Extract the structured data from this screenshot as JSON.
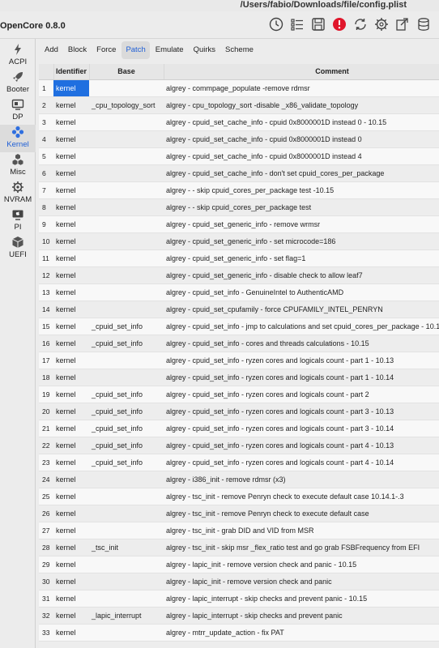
{
  "window": {
    "path": "/Users/fabio/Downloads/file/config.plist"
  },
  "toolbar": {
    "app_name": "OpenCore 0.8.0"
  },
  "sidebar": {
    "items": [
      {
        "label": "ACPI",
        "icon": "bolt-icon"
      },
      {
        "label": "Booter",
        "icon": "rocket-icon"
      },
      {
        "label": "DP",
        "icon": "display-icon"
      },
      {
        "label": "Kernel",
        "icon": "kernel-icon"
      },
      {
        "label": "Misc",
        "icon": "cubes-icon"
      },
      {
        "label": "NVRAM",
        "icon": "chip-icon"
      },
      {
        "label": "PI",
        "icon": "apple-icon"
      },
      {
        "label": "UEFI",
        "icon": "box-icon"
      }
    ],
    "active": "Kernel"
  },
  "tabs": [
    "Add",
    "Block",
    "Force",
    "Patch",
    "Emulate",
    "Quirks",
    "Scheme"
  ],
  "active_tab": "Patch",
  "table": {
    "headers": {
      "identifier": "Identifier",
      "base": "Base",
      "comment": "Comment"
    },
    "rows": [
      {
        "n": "1",
        "identifier": "kernel",
        "base": "",
        "comment": "algrey - commpage_populate -remove rdmsr"
      },
      {
        "n": "2",
        "identifier": "kernel",
        "base": "_cpu_topology_sort",
        "comment": "algrey - cpu_topology_sort -disable _x86_validate_topology"
      },
      {
        "n": "3",
        "identifier": "kernel",
        "base": "",
        "comment": "algrey - cpuid_set_cache_info - cpuid 0x8000001D instead 0 - 10.15"
      },
      {
        "n": "4",
        "identifier": "kernel",
        "base": "",
        "comment": "algrey - cpuid_set_cache_info - cpuid 0x8000001D instead 0"
      },
      {
        "n": "5",
        "identifier": "kernel",
        "base": "",
        "comment": "algrey - cpuid_set_cache_info - cpuid 0x8000001D instead 4"
      },
      {
        "n": "6",
        "identifier": "kernel",
        "base": "",
        "comment": "algrey - cpuid_set_cache_info - don't set cpuid_cores_per_package"
      },
      {
        "n": "7",
        "identifier": "kernel",
        "base": "",
        "comment": "algrey - - skip cpuid_cores_per_package test -10.15"
      },
      {
        "n": "8",
        "identifier": "kernel",
        "base": "",
        "comment": "algrey - - skip cpuid_cores_per_package test"
      },
      {
        "n": "9",
        "identifier": "kernel",
        "base": "",
        "comment": "algrey - cpuid_set_generic_info - remove wrmsr"
      },
      {
        "n": "10",
        "identifier": "kernel",
        "base": "",
        "comment": "algrey - cpuid_set_generic_info - set microcode=186"
      },
      {
        "n": "11",
        "identifier": "kernel",
        "base": "",
        "comment": "algrey - cpuid_set_generic_info - set flag=1"
      },
      {
        "n": "12",
        "identifier": "kernel",
        "base": "",
        "comment": "algrey - cpuid_set_generic_info - disable check to allow leaf7"
      },
      {
        "n": "13",
        "identifier": "kernel",
        "base": "",
        "comment": "algrey - cpuid_set_info - GenuineIntel to AuthenticAMD"
      },
      {
        "n": "14",
        "identifier": "kernel",
        "base": "",
        "comment": "algrey - cpuid_set_cpufamily - force CPUFAMILY_INTEL_PENRYN"
      },
      {
        "n": "15",
        "identifier": "kernel",
        "base": "_cpuid_set_info",
        "comment": "algrey - cpuid_set_info - jmp to calculations and set cpuid_cores_per_package - 10.1"
      },
      {
        "n": "16",
        "identifier": "kernel",
        "base": "_cpuid_set_info",
        "comment": "algrey - cpuid_set_info - cores and threads calculations - 10.15"
      },
      {
        "n": "17",
        "identifier": "kernel",
        "base": "",
        "comment": "algrey - cpuid_set_info - ryzen cores and logicals count - part 1 - 10.13"
      },
      {
        "n": "18",
        "identifier": "kernel",
        "base": "",
        "comment": "algrey - cpuid_set_info - ryzen cores and logicals count - part 1 - 10.14"
      },
      {
        "n": "19",
        "identifier": "kernel",
        "base": "_cpuid_set_info",
        "comment": "algrey - cpuid_set_info - ryzen cores and logicals count - part 2"
      },
      {
        "n": "20",
        "identifier": "kernel",
        "base": "_cpuid_set_info",
        "comment": "algrey - cpuid_set_info - ryzen cores and logicals count - part 3 - 10.13"
      },
      {
        "n": "21",
        "identifier": "kernel",
        "base": "_cpuid_set_info",
        "comment": "algrey - cpuid_set_info - ryzen cores and logicals count - part 3 - 10.14"
      },
      {
        "n": "22",
        "identifier": "kernel",
        "base": "_cpuid_set_info",
        "comment": "algrey - cpuid_set_info - ryzen cores and logicals count - part 4 - 10.13"
      },
      {
        "n": "23",
        "identifier": "kernel",
        "base": "_cpuid_set_info",
        "comment": "algrey - cpuid_set_info - ryzen cores and logicals count - part 4 - 10.14"
      },
      {
        "n": "24",
        "identifier": "kernel",
        "base": "",
        "comment": "algrey - i386_init - remove rdmsr (x3)"
      },
      {
        "n": "25",
        "identifier": "kernel",
        "base": "",
        "comment": "algrey - tsc_init - remove Penryn check to execute default case 10.14.1-.3"
      },
      {
        "n": "26",
        "identifier": "kernel",
        "base": "",
        "comment": "algrey - tsc_init - remove Penryn check to execute default case"
      },
      {
        "n": "27",
        "identifier": "kernel",
        "base": "",
        "comment": "algrey - tsc_init - grab DID and VID from MSR"
      },
      {
        "n": "28",
        "identifier": "kernel",
        "base": "_tsc_init",
        "comment": "algrey - tsc_init - skip msr _flex_ratio test and go grab FSBFrequency from EFI"
      },
      {
        "n": "29",
        "identifier": "kernel",
        "base": "",
        "comment": "algrey - lapic_init - remove version check and panic - 10.15"
      },
      {
        "n": "30",
        "identifier": "kernel",
        "base": "",
        "comment": "algrey - lapic_init - remove version check and panic"
      },
      {
        "n": "31",
        "identifier": "kernel",
        "base": "",
        "comment": "algrey - lapic_interrupt - skip checks and prevent panic - 10.15"
      },
      {
        "n": "32",
        "identifier": "kernel",
        "base": "_lapic_interrupt",
        "comment": "algrey - lapic_interrupt - skip checks and prevent panic"
      },
      {
        "n": "33",
        "identifier": "kernel",
        "base": "",
        "comment": "algrey - mtrr_update_action - fix PAT"
      },
      {
        "n": "",
        "identifier": "",
        "base": "",
        "comment": ""
      }
    ]
  },
  "colors": {
    "accent": "#1f6fe0",
    "alert": "#e0162b"
  }
}
